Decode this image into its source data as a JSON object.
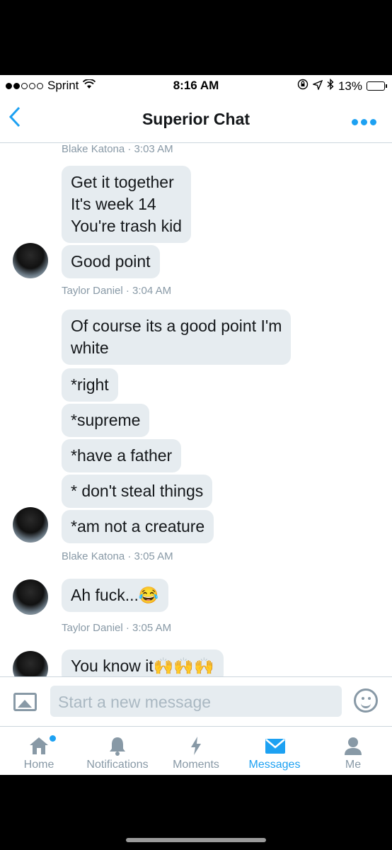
{
  "status": {
    "carrier": "Sprint",
    "time": "8:16 AM",
    "battery": "13%"
  },
  "header": {
    "title": "Superior Chat"
  },
  "messages": {
    "meta_top": "Blake Katona · 3:03 AM",
    "group1": [
      "Get it together\nIt's week 14\nYou're trash kid",
      "Good point"
    ],
    "meta1": "Taylor Daniel · 3:04 AM",
    "group2": [
      "Of course its a good point I'm\nwhite",
      "*right",
      "*supreme",
      "*have a father",
      "* don't steal things",
      "*am not a creature"
    ],
    "meta2": "Blake Katona · 3:05 AM",
    "group3": [
      "Ah fuck...😂"
    ],
    "meta3": "Taylor Daniel · 3:05 AM",
    "group4": [
      "You know it🙌🙌🙌"
    ]
  },
  "composer": {
    "placeholder": "Start a new message"
  },
  "tabs": [
    {
      "label": "Home"
    },
    {
      "label": "Notifications"
    },
    {
      "label": "Moments"
    },
    {
      "label": "Messages"
    },
    {
      "label": "Me"
    }
  ],
  "colors": {
    "accent": "#1da1f2",
    "bubble": "#e6ecf0",
    "muted": "#8899a6"
  }
}
